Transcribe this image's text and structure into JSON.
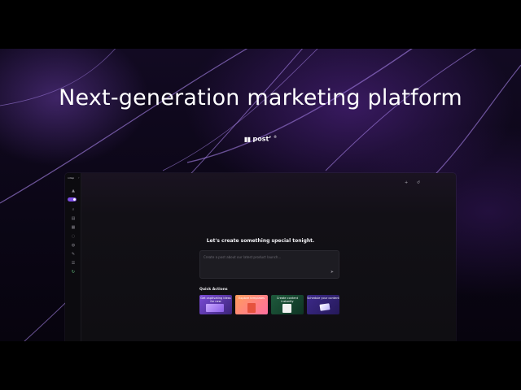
{
  "hero": {
    "title": "Next-generation marketing platform",
    "logo_text": "postʼ",
    "logo_sup": "®"
  },
  "app": {
    "brand": "ndisp",
    "headline": "Let's create something special tonight.",
    "prompt_placeholder": "Create a post about our latest product launch...",
    "quick_actions_label": "Quick Actions",
    "quick_actions": [
      {
        "label": "Get captivating ideas for new",
        "icon": "ideas-art"
      },
      {
        "label": "Explore templates",
        "icon": "templates-art"
      },
      {
        "label": "Create content instantly",
        "icon": "content-art"
      },
      {
        "label": "Schedule your content",
        "icon": "schedule-art"
      }
    ],
    "sidebar_icons": [
      "home-icon",
      "search-icon",
      "calendar-icon",
      "grid-icon",
      "chat-icon",
      "globe-icon",
      "edit-icon",
      "library-icon",
      "power-icon"
    ],
    "topbar_icons": [
      "plus-icon",
      "history-icon"
    ],
    "accent_color": "#7b4de0"
  }
}
